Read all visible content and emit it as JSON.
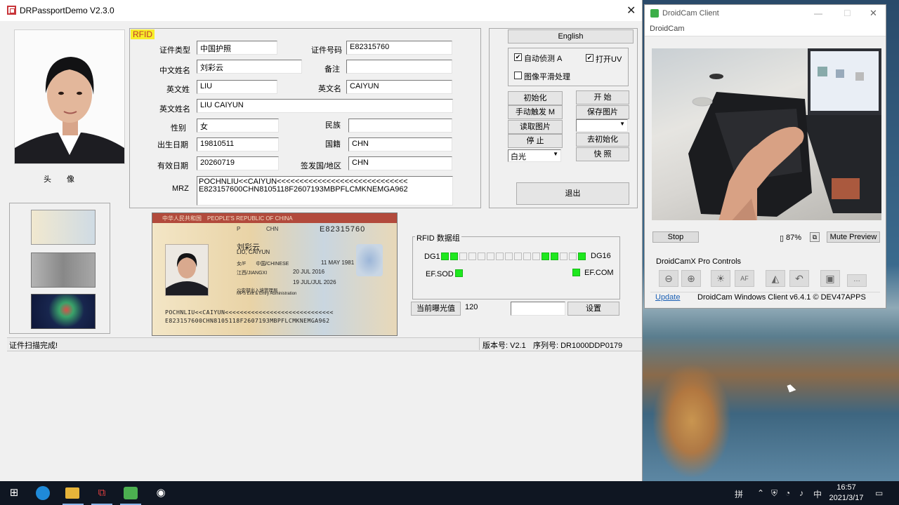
{
  "app": {
    "title": "DRPassportDemo V2.3.0",
    "close": "✕",
    "photo_label": "头　　像",
    "rfid_tag": "RFID",
    "fields": {
      "doc_type_label": "证件类型",
      "doc_type": "中国护照",
      "doc_no_label": "证件号码",
      "doc_no": "E82315760",
      "cn_name_label": "中文姓名",
      "cn_name": "刘彩云",
      "remark_label": "备注",
      "remark": "",
      "en_surname_label": "英文姓",
      "en_surname": "LIU",
      "en_given_label": "英文名",
      "en_given": "CAIYUN",
      "en_fullname_label": "英文姓名",
      "en_fullname": "LIU  CAIYUN",
      "sex_label": "性别",
      "sex": "女",
      "ethnic_label": "民族",
      "ethnic": "",
      "dob_label": "出生日期",
      "dob": "19810511",
      "nationality_label": "国籍",
      "nationality": "CHN",
      "expiry_label": "有效日期",
      "expiry": "20260719",
      "issuer_label": "签发国/地区",
      "issuer": "CHN",
      "mrz_label": "MRZ",
      "mrz_line1": "POCHNLIU<<CAIYUN<<<<<<<<<<<<<<<<<<<<<<<<<<<<<",
      "mrz_line2": "E823157600CHN8105118F2607193MBPFLCMKNEMGA962"
    },
    "buttons": {
      "english": "English",
      "auto_detect": "自动侦测 A",
      "open_uv": "打开UV",
      "smooth": "图像平滑处理",
      "init": "初始化",
      "start": "开 始",
      "manual": "手动触发 M",
      "save_image": "保存图片",
      "read_image": "读取图片",
      "stop": "停 止",
      "deinit": "去初始化",
      "light_select": "白光",
      "snapshot": "快 照",
      "exit": "退出",
      "exposure": "当前曝光值",
      "exposure_value": "120",
      "settings": "设置"
    },
    "rfid_group": {
      "title": "RFID 数据组",
      "dg1": "DG1",
      "dg16": "DG16",
      "ef_sod": "EF.SOD",
      "ef_com": "EF.COM",
      "dg_states": [
        true,
        true,
        false,
        false,
        false,
        false,
        false,
        false,
        false,
        false,
        false,
        true,
        true,
        false,
        false,
        true
      ]
    },
    "passport_image": {
      "header": "中华人民共和国　PEOPLE'S REPUBLIC OF CHINA",
      "type": "P",
      "code": "CHN",
      "number": "E82315760",
      "name_cn": "刘彩云",
      "name_en": "LIU, CAIYUN",
      "sex_nat": "女/F　　中国/CHINESE",
      "dob": "11 MAY 1981",
      "place": "江西/JIANGXI",
      "issue": "20 JUL 2016",
      "expiry": "19 JUL/JUL 2026",
      "authority": "公安部出入境管理局",
      "authority_en": "MPS Exit & Entry Administration"
    },
    "status": {
      "message": "证件扫描完成!",
      "version": "版本号: V2.1",
      "serial": "序列号: DR1000DDP0179"
    }
  },
  "droidcam": {
    "title": "DroidCam Client",
    "menu": "DroidCam",
    "stop": "Stop",
    "battery": "87%",
    "mute": "Mute Preview",
    "pro_title": "DroidCamX Pro Controls",
    "update": "Update",
    "version": "DroidCam Windows Client v6.4.1 © DEV47APPS",
    "tools": [
      "zoom-out-icon",
      "zoom-in-icon",
      "brightness-icon",
      "autofocus-icon",
      "flip-icon",
      "rotate-icon",
      "screenshot-icon",
      "more-icon"
    ]
  },
  "taskbar": {
    "time": "16:57",
    "date": "2021/3/17"
  }
}
